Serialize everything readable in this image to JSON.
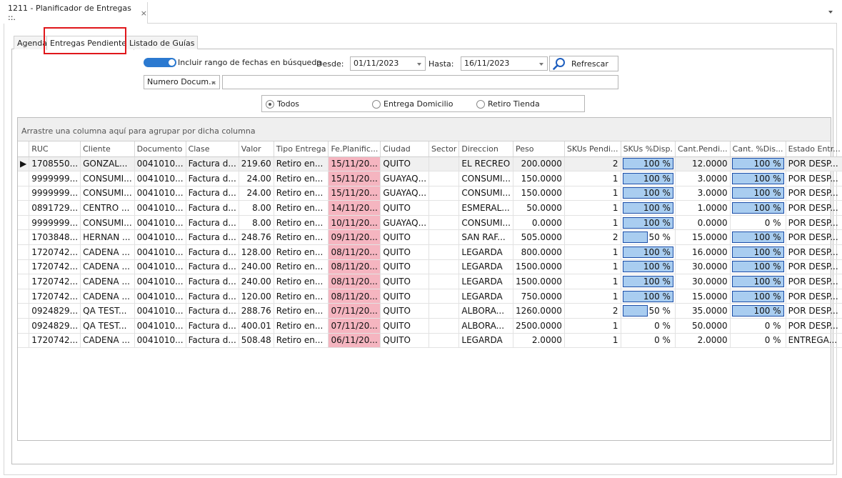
{
  "window": {
    "tab_title": "1211 - Planificador de Entregas ::.",
    "tab_close": "×"
  },
  "inner_tabs": [
    "Agenda",
    "Entregas Pendientes",
    "Listado de Guías"
  ],
  "active_tab": "Entregas Pendientes",
  "filters": {
    "toggle_label": "Incluir rango de fechas en búsqueda",
    "toggle_on": true,
    "desde_label": "Desde:",
    "desde_value": "01/11/2023",
    "hasta_label": "Hasta:",
    "hasta_value": "16/11/2023",
    "refresh_label": "Refrescar",
    "search_field_value": "Numero Docum...",
    "search_text": "",
    "radio_options": [
      "Todos",
      "Entrega Domicilio",
      "Retiro Tienda"
    ],
    "radio_selected": "Todos"
  },
  "grid": {
    "group_hint": "Arrastre una columna aquí para agrupar por dicha columna",
    "focused_indicator": "▶",
    "columns": [
      "RUC",
      "Cliente",
      "Documento",
      "Clase",
      "Valor",
      "Tipo Entrega",
      "Fe.Planific...",
      "Ciudad",
      "Sector",
      "Direccion",
      "Peso",
      "SKUs Pendi...",
      "SKUs %Disp.",
      "Cant.Pendi...",
      "Cant. %Dis...",
      "Estado Entr..."
    ],
    "rows": [
      {
        "ruc": "1708550...",
        "cliente": "GONZAL...",
        "documento": "0041010...",
        "clase": "Factura d...",
        "valor": "219.60",
        "tipo": "Retiro en...",
        "fe": "15/11/20...",
        "ciudad": "QUITO",
        "sector": "",
        "direccion": "EL RECREO",
        "peso": "200.0000",
        "skus": "2",
        "skus_pct": "100 %",
        "skus_frac": 1.0,
        "cant": "12.0000",
        "cant_pct": "100 %",
        "cant_frac": 1.0,
        "estado": "POR DESP..."
      },
      {
        "ruc": "9999999...",
        "cliente": "CONSUMI...",
        "documento": "0041010...",
        "clase": "Factura d...",
        "valor": "24.00",
        "tipo": "Retiro en...",
        "fe": "15/11/20...",
        "ciudad": "GUAYAQ...",
        "sector": "",
        "direccion": "CONSUMI...",
        "peso": "150.0000",
        "skus": "1",
        "skus_pct": "100 %",
        "skus_frac": 1.0,
        "cant": "3.0000",
        "cant_pct": "100 %",
        "cant_frac": 1.0,
        "estado": "POR DESP..."
      },
      {
        "ruc": "9999999...",
        "cliente": "CONSUMI...",
        "documento": "0041010...",
        "clase": "Factura d...",
        "valor": "24.00",
        "tipo": "Retiro en...",
        "fe": "15/11/20...",
        "ciudad": "GUAYAQ...",
        "sector": "",
        "direccion": "CONSUMI...",
        "peso": "150.0000",
        "skus": "1",
        "skus_pct": "100 %",
        "skus_frac": 1.0,
        "cant": "3.0000",
        "cant_pct": "100 %",
        "cant_frac": 1.0,
        "estado": "POR DESP..."
      },
      {
        "ruc": "0891729...",
        "cliente": "CENTRO ...",
        "documento": "0041010...",
        "clase": "Factura d...",
        "valor": "8.00",
        "tipo": "Retiro en...",
        "fe": "14/11/20...",
        "ciudad": "QUITO",
        "sector": "",
        "direccion": "ESMERAL...",
        "peso": "50.0000",
        "skus": "1",
        "skus_pct": "100 %",
        "skus_frac": 1.0,
        "cant": "1.0000",
        "cant_pct": "100 %",
        "cant_frac": 1.0,
        "estado": "POR DESP..."
      },
      {
        "ruc": "9999999...",
        "cliente": "CONSUMI...",
        "documento": "0041010...",
        "clase": "Factura d...",
        "valor": "8.00",
        "tipo": "Retiro en...",
        "fe": "10/11/20...",
        "ciudad": "GUAYAQ...",
        "sector": "",
        "direccion": "CONSUMI...",
        "peso": "0.0000",
        "skus": "1",
        "skus_pct": "100 %",
        "skus_frac": 1.0,
        "cant": "0.0000",
        "cant_pct": "0 %",
        "cant_frac": 0.0,
        "estado": "POR DESP..."
      },
      {
        "ruc": "1703848...",
        "cliente": "HERNAN ...",
        "documento": "0041010...",
        "clase": "Factura d...",
        "valor": "248.76",
        "tipo": "Retiro en...",
        "fe": "09/11/20...",
        "ciudad": "QUITO",
        "sector": "",
        "direccion": "SAN RAF...",
        "peso": "505.0000",
        "skus": "2",
        "skus_pct": "50 %",
        "skus_frac": 0.5,
        "cant": "15.0000",
        "cant_pct": "100 %",
        "cant_frac": 1.0,
        "estado": "POR DESP..."
      },
      {
        "ruc": "1720742...",
        "cliente": "CADENA ...",
        "documento": "0041010...",
        "clase": "Factura d...",
        "valor": "128.00",
        "tipo": "Retiro en...",
        "fe": "08/11/20...",
        "ciudad": "QUITO",
        "sector": "",
        "direccion": "LEGARDA",
        "peso": "800.0000",
        "skus": "1",
        "skus_pct": "100 %",
        "skus_frac": 1.0,
        "cant": "16.0000",
        "cant_pct": "100 %",
        "cant_frac": 1.0,
        "estado": "POR DESP..."
      },
      {
        "ruc": "1720742...",
        "cliente": "CADENA ...",
        "documento": "0041010...",
        "clase": "Factura d...",
        "valor": "240.00",
        "tipo": "Retiro en...",
        "fe": "08/11/20...",
        "ciudad": "QUITO",
        "sector": "",
        "direccion": "LEGARDA",
        "peso": "1500.0000",
        "skus": "1",
        "skus_pct": "100 %",
        "skus_frac": 1.0,
        "cant": "30.0000",
        "cant_pct": "100 %",
        "cant_frac": 1.0,
        "estado": "POR DESP..."
      },
      {
        "ruc": "1720742...",
        "cliente": "CADENA ...",
        "documento": "0041010...",
        "clase": "Factura d...",
        "valor": "240.00",
        "tipo": "Retiro en...",
        "fe": "08/11/20...",
        "ciudad": "QUITO",
        "sector": "",
        "direccion": "LEGARDA",
        "peso": "1500.0000",
        "skus": "1",
        "skus_pct": "100 %",
        "skus_frac": 1.0,
        "cant": "30.0000",
        "cant_pct": "100 %",
        "cant_frac": 1.0,
        "estado": "POR DESP..."
      },
      {
        "ruc": "1720742...",
        "cliente": "CADENA ...",
        "documento": "0041010...",
        "clase": "Factura d...",
        "valor": "120.00",
        "tipo": "Retiro en...",
        "fe": "08/11/20...",
        "ciudad": "QUITO",
        "sector": "",
        "direccion": "LEGARDA",
        "peso": "750.0000",
        "skus": "1",
        "skus_pct": "100 %",
        "skus_frac": 1.0,
        "cant": "15.0000",
        "cant_pct": "100 %",
        "cant_frac": 1.0,
        "estado": "POR DESP..."
      },
      {
        "ruc": "0924829...",
        "cliente": "QA TEST...",
        "documento": "0041010...",
        "clase": "Factura d...",
        "valor": "288.76",
        "tipo": "Retiro en...",
        "fe": "07/11/20...",
        "ciudad": "QUITO",
        "sector": "",
        "direccion": "ALBORA...",
        "peso": "1260.0000",
        "skus": "2",
        "skus_pct": "50 %",
        "skus_frac": 0.5,
        "cant": "35.0000",
        "cant_pct": "100 %",
        "cant_frac": 1.0,
        "estado": "POR DESP..."
      },
      {
        "ruc": "0924829...",
        "cliente": "QA TEST...",
        "documento": "0041010...",
        "clase": "Factura d...",
        "valor": "400.01",
        "tipo": "Retiro en...",
        "fe": "07/11/20...",
        "ciudad": "QUITO",
        "sector": "",
        "direccion": "ALBORA...",
        "peso": "2500.0000",
        "skus": "1",
        "skus_pct": "0 %",
        "skus_frac": 0.0,
        "cant": "50.0000",
        "cant_pct": "0 %",
        "cant_frac": 0.0,
        "estado": "POR DESP..."
      },
      {
        "ruc": "1720742...",
        "cliente": "CADENA ...",
        "documento": "0041010...",
        "clase": "Factura d...",
        "valor": "508.48",
        "tipo": "Retiro en...",
        "fe": "06/11/20...",
        "ciudad": "QUITO",
        "sector": "",
        "direccion": "LEGARDA",
        "peso": "2.0000",
        "skus": "1",
        "skus_pct": "0 %",
        "skus_frac": 0.0,
        "cant": "2.0000",
        "cant_pct": "0 %",
        "cant_frac": 0.0,
        "estado": "ENTREGA..."
      }
    ]
  },
  "colors": {
    "toggle": "#2b79d0",
    "date_cell": "#f5b5c0",
    "progress_fill": "#a9cdf0",
    "highlight": "#e0171b"
  }
}
